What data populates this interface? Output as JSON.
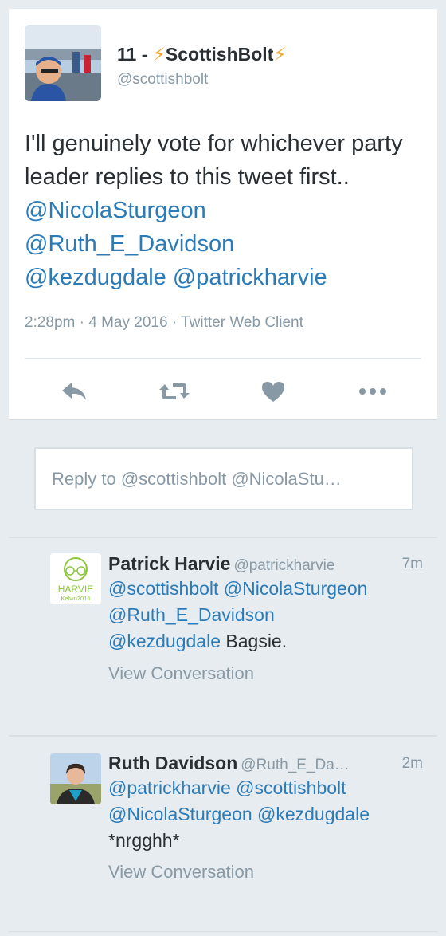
{
  "tweet": {
    "author_name": "11 - ",
    "author_name_rest": "ScottishBolt",
    "author_handle": "@scottishbolt",
    "text_plain": "I'll genuinely vote for whichever party leader replies to this tweet first.. ",
    "mentions": [
      "@NicolaSturgeon",
      "@Ruth_E_Davidson",
      "@kezdugdale",
      "@patrickharvie"
    ],
    "meta": "2:28pm · 4 May 2016 · Twitter Web Client"
  },
  "actions": {
    "reply_icon": "reply-icon",
    "retweet_icon": "retweet-icon",
    "like_icon": "heart-icon",
    "more_icon": "more-icon"
  },
  "reply_box": {
    "placeholder": "Reply to @scottishbolt @NicolaStu…"
  },
  "replies": [
    {
      "name": "Patrick Harvie",
      "handle": "@patrickharvie",
      "time": "7m",
      "avatar_text_top": "HARVIE",
      "avatar_text_bottom": "Kelvin2016",
      "mentions_line1": "@scottishbolt @NicolaSturgeon",
      "mentions_line2": "@Ruth_E_Davidson",
      "mentions_line3": "@kezdugdale",
      "text": " Bagsie.",
      "view": "View Conversation"
    },
    {
      "name": "Ruth Davidson",
      "handle": "@Ruth_E_Da…",
      "time": "2m",
      "mentions_line1": "@patrickharvie @scottishbolt",
      "mentions_line2": "@NicolaSturgeon @kezdugdale",
      "text": "*nrgghh*",
      "view": "View Conversation"
    }
  ],
  "colors": {
    "link": "#2b7bb9",
    "muted": "#8899a6",
    "bolt": "#f5a623",
    "background": "#e6ecf0"
  }
}
